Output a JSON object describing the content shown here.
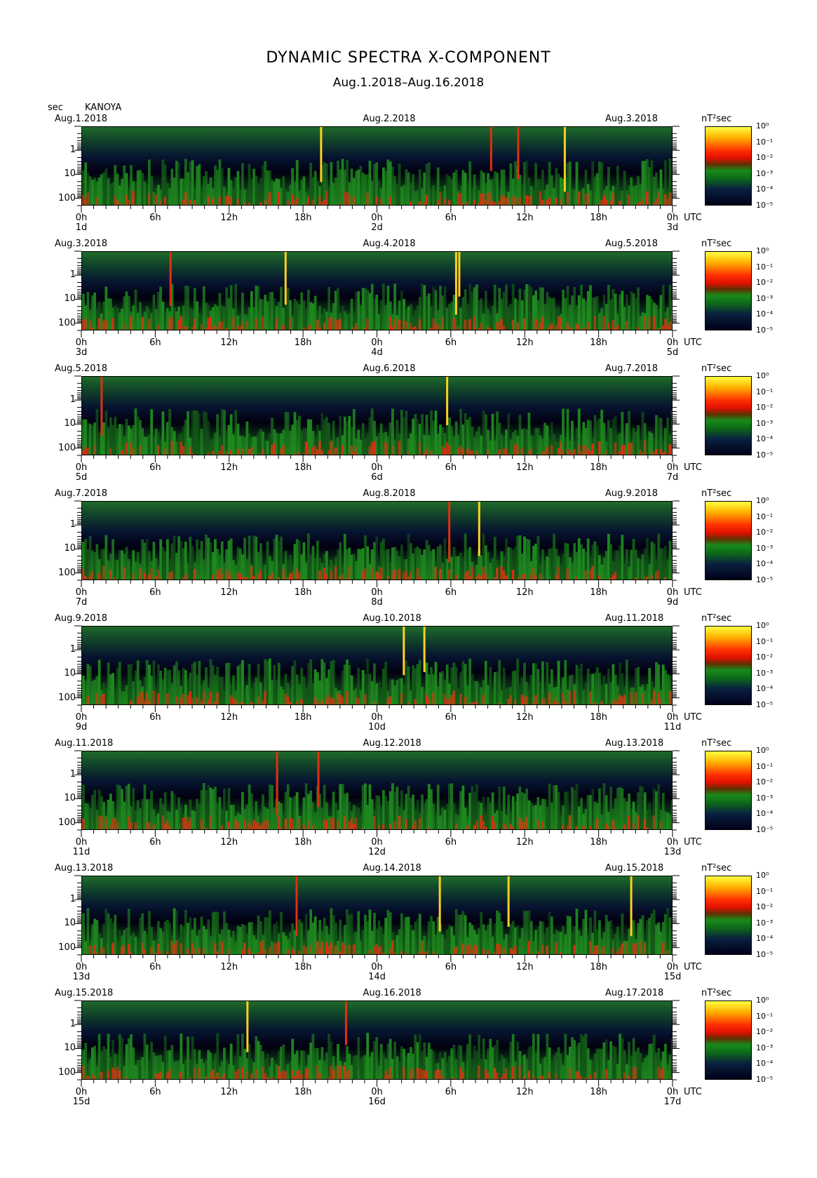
{
  "title": "DYNAMIC SPECTRA X-COMPONENT",
  "subtitle": "Aug.1.2018–Aug.16.2018",
  "y_unit": "sec",
  "station": "KANOYA",
  "colorbar_unit": "nT²sec",
  "colorbar_ticks": [
    "10⁰",
    "10⁻¹",
    "10⁻²",
    "10⁻³",
    "10⁻⁴",
    "10⁻⁵"
  ],
  "utc_label": "UTC",
  "y_ticks": [
    "1",
    "10",
    "100"
  ],
  "x_ticks": [
    "0h",
    "6h",
    "12h",
    "18h",
    "0h",
    "6h",
    "12h",
    "18h",
    "0h"
  ],
  "colors": {
    "low": "#000018",
    "mid": "#1a8a1a",
    "high": "#ff3000",
    "peak": "#ffff40"
  },
  "chart_data": {
    "type": "heatmap",
    "title": "DYNAMIC SPECTRA X-COMPONENT",
    "subtitle": "Aug.1.2018–Aug.16.2018",
    "xlabel": "UTC",
    "ylabel": "sec",
    "y_scale": "log",
    "ylim": [
      0.1,
      200
    ],
    "colorbar": {
      "label": "nT²sec",
      "scale": "log",
      "range": [
        1e-05,
        1
      ]
    },
    "panels": [
      {
        "left_date": "Aug.1.2018",
        "mid_date": "Aug.2.2018",
        "right_date": "Aug.3.2018",
        "days": [
          "1d",
          "2d",
          "3d"
        ]
      },
      {
        "left_date": "Aug.3.2018",
        "mid_date": "Aug.4.2018",
        "right_date": "Aug.5.2018",
        "days": [
          "3d",
          "4d",
          "5d"
        ]
      },
      {
        "left_date": "Aug.5.2018",
        "mid_date": "Aug.6.2018",
        "right_date": "Aug.7.2018",
        "days": [
          "5d",
          "6d",
          "7d"
        ]
      },
      {
        "left_date": "Aug.7.2018",
        "mid_date": "Aug.8.2018",
        "right_date": "Aug.9.2018",
        "days": [
          "7d",
          "8d",
          "9d"
        ]
      },
      {
        "left_date": "Aug.9.2018",
        "mid_date": "Aug.10.2018",
        "right_date": "Aug.11.2018",
        "days": [
          "9d",
          "10d",
          "11d"
        ]
      },
      {
        "left_date": "Aug.11.2018",
        "mid_date": "Aug.12.2018",
        "right_date": "Aug.13.2018",
        "days": [
          "11d",
          "12d",
          "13d"
        ]
      },
      {
        "left_date": "Aug.13.2018",
        "mid_date": "Aug.14.2018",
        "right_date": "Aug.15.2018",
        "days": [
          "13d",
          "14d",
          "15d"
        ]
      },
      {
        "left_date": "Aug.15.2018",
        "mid_date": "Aug.16.2018",
        "right_date": "Aug.17.2018",
        "days": [
          "15d",
          "16d",
          "17d"
        ]
      }
    ]
  }
}
